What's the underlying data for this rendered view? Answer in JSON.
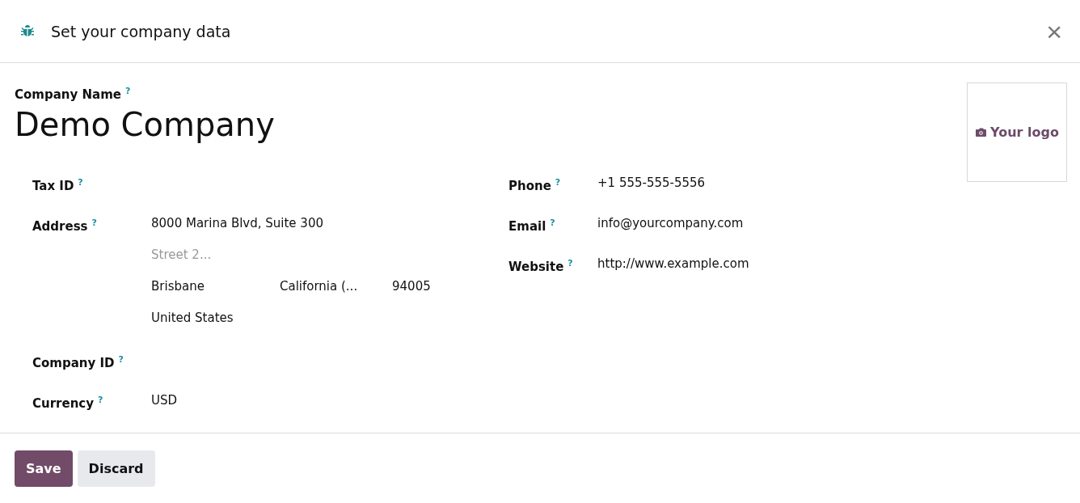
{
  "dialog": {
    "title": "Set your company data",
    "close": "×"
  },
  "company_name": {
    "label": "Company Name",
    "help": "?",
    "value": "Demo Company"
  },
  "logo": {
    "text": "Your logo"
  },
  "left_fields": [
    {
      "kind": "text",
      "label": "Tax ID",
      "help": "?"
    },
    {
      "kind": "address",
      "label": "Address",
      "help": "?",
      "street": "8000 Marina Blvd, Suite 300",
      "street2_placeholder": "Street 2...",
      "city": "Brisbane",
      "state": "California (...",
      "zip": "94005",
      "country": "United States"
    },
    {
      "kind": "text",
      "label": "Company ID",
      "help": "?"
    },
    {
      "kind": "text",
      "label": "Currency",
      "help": "?",
      "value": "USD"
    }
  ],
  "right_fields": [
    {
      "kind": "text",
      "label": "Phone",
      "help": "?",
      "value": "+1 555-555-5556"
    },
    {
      "kind": "text",
      "label": "Email",
      "help": "?",
      "value": "info@yourcompany.com"
    },
    {
      "kind": "text",
      "label": "Website",
      "help": "?",
      "value": "http://www.example.com"
    }
  ],
  "buttons": [
    {
      "label": "Save",
      "kind": "primary"
    },
    {
      "label": "Discard",
      "kind": "secondary"
    }
  ]
}
